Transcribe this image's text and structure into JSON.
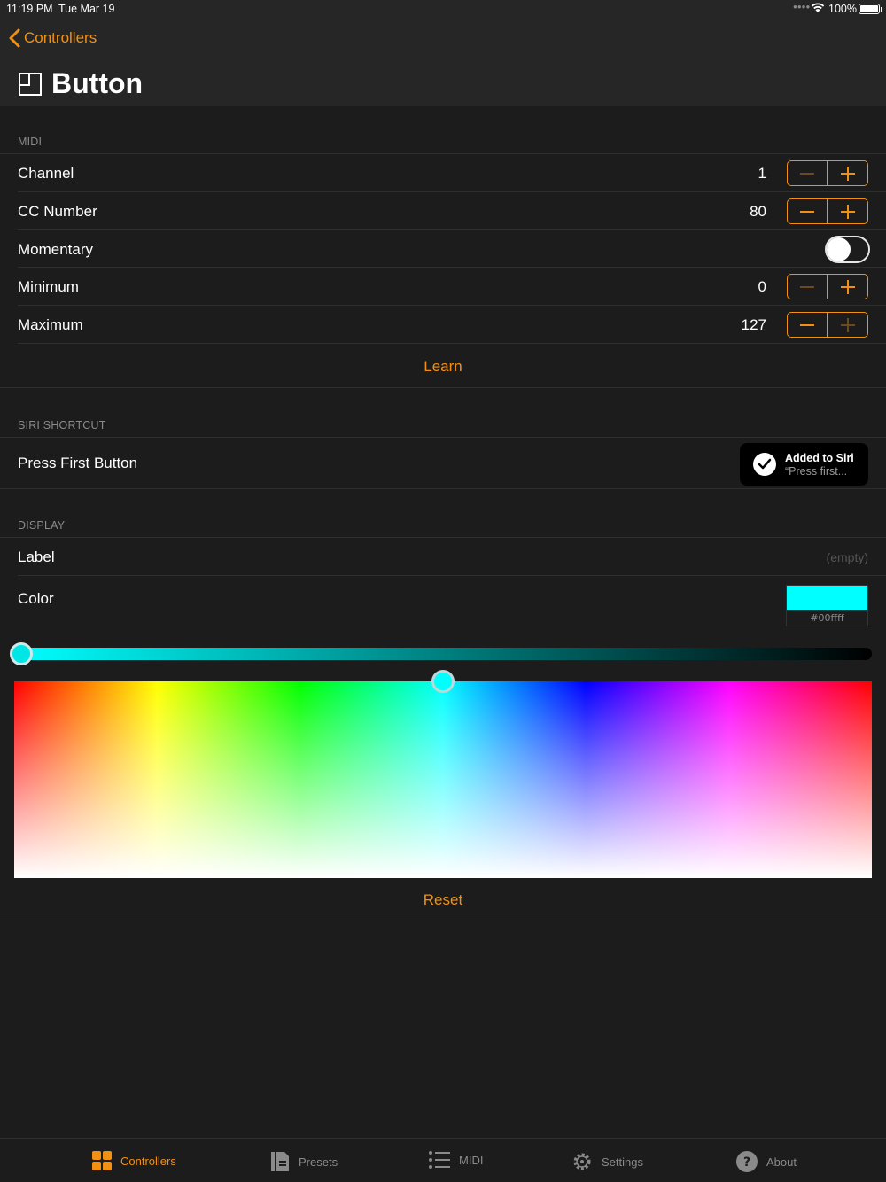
{
  "status_bar": {
    "time": "11:19 PM",
    "date": "Tue Mar 19",
    "battery": "100%"
  },
  "nav": {
    "back_label": "Controllers",
    "title": "Button"
  },
  "midi": {
    "header": "MIDI",
    "rows": [
      {
        "label": "Channel",
        "value": "1"
      },
      {
        "label": "CC Number",
        "value": "80"
      },
      {
        "label": "Momentary"
      },
      {
        "label": "Minimum",
        "value": "0"
      },
      {
        "label": "Maximum",
        "value": "127"
      }
    ],
    "learn_label": "Learn"
  },
  "siri": {
    "header": "SIRI SHORTCUT",
    "row_label": "Press First Button",
    "button_title": "Added to Siri",
    "button_subtitle": "“Press first..."
  },
  "display": {
    "header": "DISPLAY",
    "label_row": "Label",
    "label_value": "(empty)",
    "color_row": "Color",
    "color_hex": "#00ffff",
    "reset_label": "Reset"
  },
  "colors": {
    "accent": "#f29111",
    "background": "#1c1c1c",
    "selected_color": "#00ffff"
  },
  "tabs": [
    {
      "label": "Controllers",
      "icon": "grid-icon",
      "active": true
    },
    {
      "label": "Presets",
      "icon": "document-icon",
      "active": false
    },
    {
      "label": "MIDI",
      "icon": "list-icon",
      "active": false
    },
    {
      "label": "Settings",
      "icon": "gear-icon",
      "active": false
    },
    {
      "label": "About",
      "icon": "question-icon",
      "active": false
    }
  ]
}
